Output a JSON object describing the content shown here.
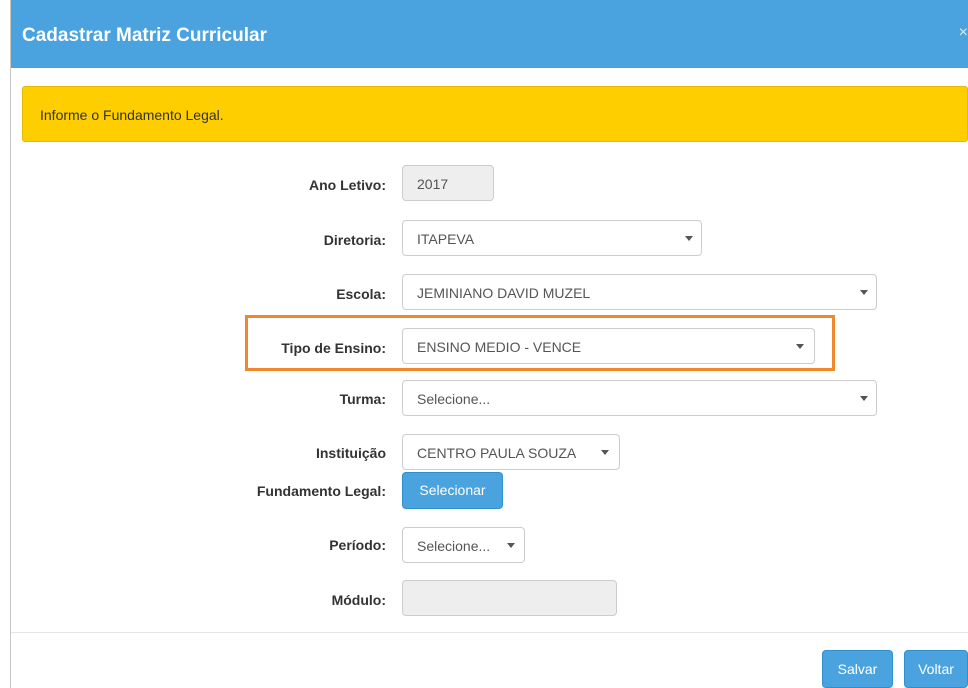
{
  "modal": {
    "title": "Cadastrar Matriz Curricular",
    "close_glyph": "×"
  },
  "alert": {
    "message": "Informe o Fundamento Legal."
  },
  "form": {
    "ano_letivo": {
      "label": "Ano Letivo:",
      "value": "2017"
    },
    "diretoria": {
      "label": "Diretoria:",
      "value": "ITAPEVA"
    },
    "escola": {
      "label": "Escola:",
      "value": "JEMINIANO DAVID MUZEL"
    },
    "tipo_ensino": {
      "label": "Tipo de Ensino:",
      "value": "ENSINO MEDIO - VENCE"
    },
    "turma": {
      "label": "Turma:",
      "value": "Selecione..."
    },
    "instituicao": {
      "label": "Instituição",
      "value": "CENTRO PAULA SOUZA"
    },
    "fundamento_legal": {
      "label": "Fundamento Legal:",
      "button": "Selecionar"
    },
    "periodo": {
      "label": "Período:",
      "value": "Selecione..."
    },
    "modulo": {
      "label": "Módulo:",
      "value": ""
    }
  },
  "footer": {
    "save_label": "Salvar",
    "back_label": "Voltar"
  },
  "colors": {
    "header": "#4aa3df",
    "alert": "#fece00",
    "highlight": "#f0882e",
    "button": "#4aa3df"
  }
}
